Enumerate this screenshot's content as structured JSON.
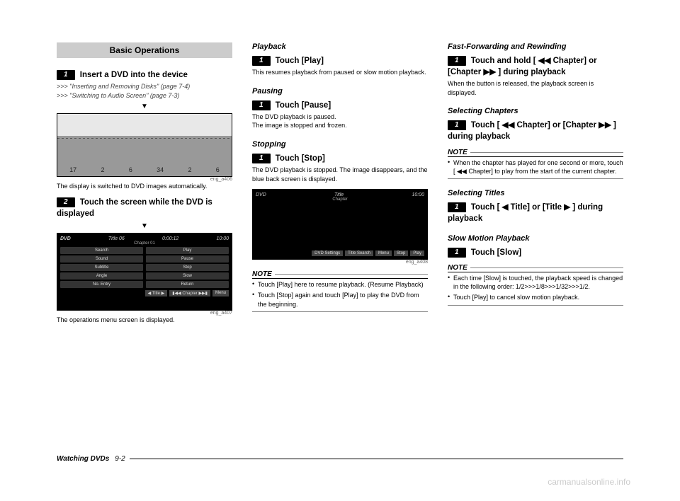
{
  "header": {
    "title": "Basic Operations"
  },
  "col1": {
    "step1": {
      "num": "1",
      "text": "Insert a DVD into the device",
      "xref1": ">>> \"Inserting and Removing Disks\" (page 7-4)",
      "xref2": ">>> \"Switching to Audio Screen\" (page 7-3)"
    },
    "fig1_caption_id": "eng_a406",
    "fig1_caption": "The display is switched to DVD images automatically.",
    "step2": {
      "num": "2",
      "text": "Touch the screen while the DVD is displayed"
    },
    "fig2": {
      "topbar_left": "DVD",
      "topbar_mid": "Title 06",
      "topbar_time": "0:00:12",
      "topbar_clock": "10:00",
      "sub": "Chapter 01",
      "left_buttons": [
        "Search",
        "Sound",
        "Subtitle",
        "Angle",
        "No. Entry"
      ],
      "right_buttons": [
        "Play",
        "Pause",
        "Stop",
        "Slow",
        "Return"
      ],
      "bottom": [
        "◀ Title ▶",
        "▮◀◀ Chapter ▶▶▮",
        "Menu"
      ]
    },
    "fig2_caption_id": "eng_a407",
    "fig2_caption": "The operations menu screen is displayed."
  },
  "col2": {
    "playback": {
      "head": "Playback",
      "num": "1",
      "step": "Touch [Play]",
      "body": "This resumes playback from paused or slow motion playback."
    },
    "pausing": {
      "head": "Pausing",
      "num": "1",
      "step": "Touch [Pause]",
      "body1": "The DVD playback is paused.",
      "body2": "The image is stopped and frozen."
    },
    "stopping": {
      "head": "Stopping",
      "num": "1",
      "step": "Touch [Stop]",
      "body": "The DVD playback is stopped. The image disappears, and the blue back screen is displayed."
    },
    "fig3": {
      "topbar_left": "DVD",
      "topbar_mid": "Title",
      "topbar_clock": "10:00",
      "sub": "Chapter",
      "bottom": [
        "DVD Settings",
        "Title Search",
        "Menu",
        "Stop",
        "Play"
      ]
    },
    "fig3_caption_id": "eng_a408",
    "note_hdr": "NOTE",
    "note_items": [
      "Touch [Play] here to resume playback. (Resume Playback)",
      "Touch [Stop] again and touch [Play] to play the DVD from the beginning."
    ]
  },
  "col3": {
    "ff": {
      "head": "Fast-Forwarding and Rewinding",
      "num": "1",
      "step": "Touch and hold [ ◀◀ Chapter] or [Chapter ▶▶ ] during playback",
      "body": "When the button is released, the playback screen is displayed."
    },
    "chapters": {
      "head": "Selecting Chapters",
      "num": "1",
      "step": "Touch [ ◀◀ Chapter] or [Chapter ▶▶ ] during playback",
      "note_hdr": "NOTE",
      "note": "When the chapter has played for one second or more, touch [ ◀◀ Chapter] to play from the start of the current chapter."
    },
    "titles": {
      "head": "Selecting Titles",
      "num": "1",
      "step": "Touch [ ◀ Title] or [Title ▶ ] during playback"
    },
    "slow": {
      "head": "Slow Motion Playback",
      "num": "1",
      "step": "Touch [Slow]",
      "note_hdr": "NOTE",
      "notes": [
        "Each time [Slow] is touched, the playback speed is changed in the following order: 1/2>>>1/8>>>1/32>>>1/2.",
        "Touch [Play] to cancel slow motion playback."
      ]
    }
  },
  "footer": {
    "label": "Watching DVDs",
    "page": "9-2"
  },
  "watermark": "carmanualsonline.info"
}
